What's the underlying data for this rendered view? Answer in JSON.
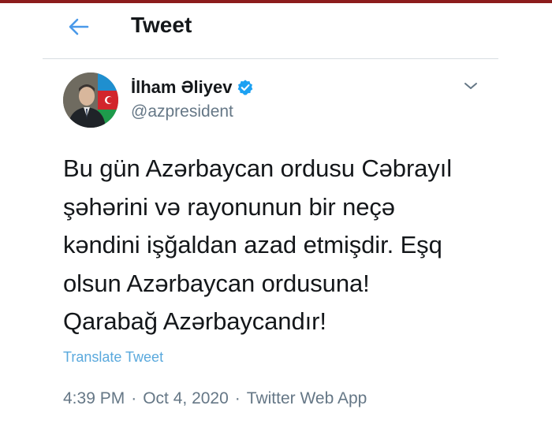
{
  "header": {
    "title": "Tweet",
    "back_icon": "back-arrow-icon",
    "accent_color": "#4a99e9"
  },
  "tweet": {
    "author": {
      "display_name": "İlham Əliyev",
      "handle": "@azpresident",
      "verified": true,
      "verified_color": "#1da1f2"
    },
    "text": "Bu gün Azərbaycan ordusu Cəbrayıl\nşəhərini  və rayonunun bir neçə\nkəndini işğaldan azad etmişdir. Eşq\nolsun Azərbaycan ordusuna!\nQarabağ Azərbaycandır!",
    "translate_label": "Translate Tweet",
    "time": "4:39 PM",
    "separator": "·",
    "date": "Oct 4, 2020",
    "source": "Twitter Web App"
  }
}
